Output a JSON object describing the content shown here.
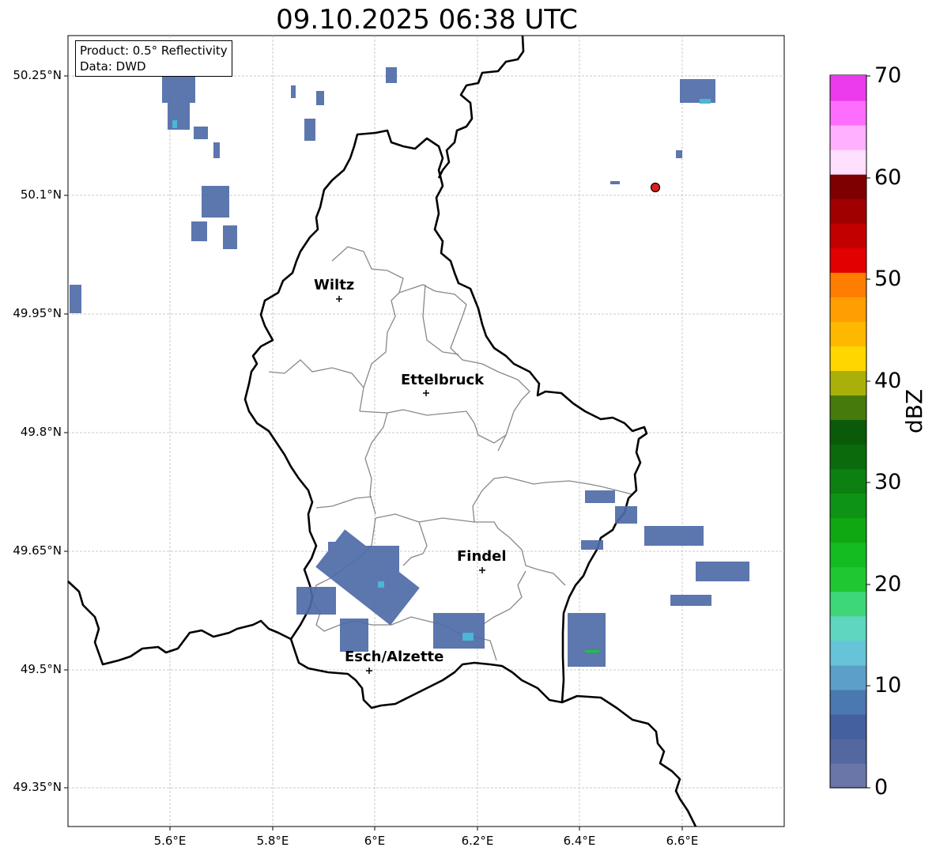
{
  "title": "09.10.2025 06:38 UTC",
  "info": {
    "product": "Product: 0.5° Reflectivity",
    "data": "Data: DWD"
  },
  "axes": {
    "lat_labels": [
      "50.25°N",
      "50.1°N",
      "49.95°N",
      "49.8°N",
      "49.65°N",
      "49.5°N",
      "49.35°N"
    ],
    "lon_labels": [
      "5.6°E",
      "5.8°E",
      "6°E",
      "6.2°E",
      "6.4°E",
      "6.6°E"
    ]
  },
  "cities": [
    {
      "name": "Wiltz"
    },
    {
      "name": "Ettelbruck"
    },
    {
      "name": "Findel"
    },
    {
      "name": "Esch/Alzette"
    }
  ],
  "colorbar": {
    "label": "dBZ",
    "ticks": [
      "70",
      "60",
      "50",
      "40",
      "30",
      "20",
      "10",
      "0"
    ],
    "colors": [
      "#6a76a8",
      "#5367a0",
      "#44609f",
      "#4a78b0",
      "#5c9fc8",
      "#66c3d8",
      "#5fd6c0",
      "#3fd67a",
      "#1fc832",
      "#14bc22",
      "#10a812",
      "#0e9414",
      "#0c8011",
      "#0a6b0c",
      "#0a5a0a",
      "#467a0c",
      "#a9b00a",
      "#ffd600",
      "#ffb800",
      "#ff9e00",
      "#ff7d00",
      "#e30000",
      "#c20000",
      "#a10000",
      "#7f0000",
      "#ffe0ff",
      "#ffb0ff",
      "#ff6dff",
      "#ec3bec"
    ]
  },
  "colors": {
    "echo": "#4f6ba8",
    "echo_core": "#4bb6d6",
    "echo_green": "#18c832",
    "marker": "#e31b1b",
    "border_country": "#000000",
    "border_canton": "#888888",
    "grid": "#bbbbbb"
  }
}
